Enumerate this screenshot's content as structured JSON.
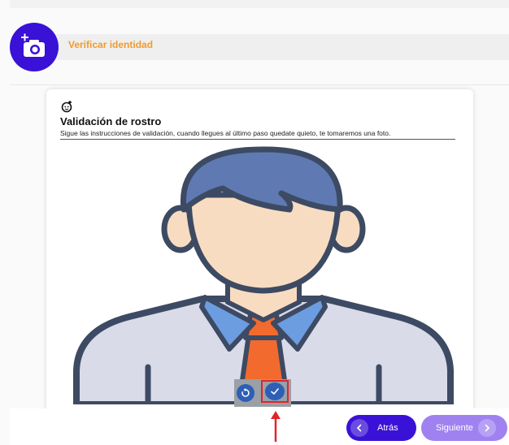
{
  "header": {
    "title": "Verificar identidad",
    "icon": "camera-plus-icon"
  },
  "card": {
    "icon": "face-scan-icon",
    "title": "Validación de rostro",
    "subtitle": "Sigue las instrucciones de validación, cuando llegues al último paso quedate quieto, te tomaremos una foto."
  },
  "camera_controls": {
    "retake_icon": "retake-icon",
    "confirm_icon": "check-icon"
  },
  "footer": {
    "back_label": "Atrás",
    "next_label": "Siguiente"
  },
  "colors": {
    "primary": "#3a11d6",
    "primary_light": "#9f82f0",
    "header_title": "#f29a28",
    "highlight": "#e0252a"
  }
}
